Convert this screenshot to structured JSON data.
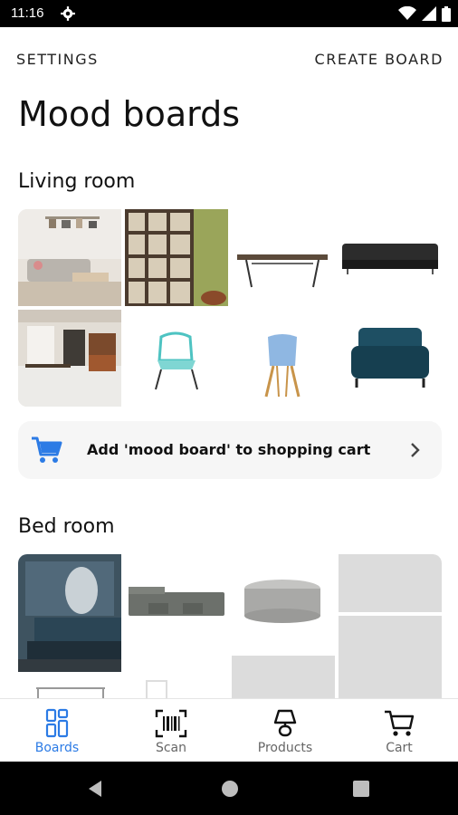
{
  "status": {
    "time": "11:16"
  },
  "header": {
    "settings_label": "SETTINGS",
    "create_board_label": "CREATE BOARD"
  },
  "page": {
    "title": "Mood boards"
  },
  "boards": [
    {
      "name": "Living room",
      "cart_label": "Add 'mood board' to shopping cart"
    },
    {
      "name": "Bed room"
    }
  ],
  "nav": [
    {
      "label": "Boards",
      "icon": "grid-icon",
      "active": true
    },
    {
      "label": "Scan",
      "icon": "barcode-scan-icon",
      "active": false
    },
    {
      "label": "Products",
      "icon": "lamp-icon",
      "active": false
    },
    {
      "label": "Cart",
      "icon": "cart-icon",
      "active": false
    }
  ],
  "colors": {
    "accent": "#2c7be5",
    "nav_inactive": "#666666"
  }
}
